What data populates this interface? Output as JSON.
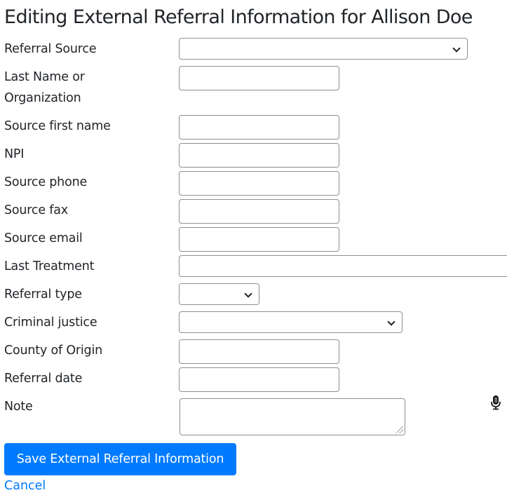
{
  "page": {
    "title": "Editing External Referral Information for Allison Doe"
  },
  "form": {
    "fields": [
      {
        "label": "Referral Source",
        "type": "select",
        "value": ""
      },
      {
        "label": "Last Name or Organization",
        "type": "text",
        "value": ""
      },
      {
        "label": "Source first name",
        "type": "text",
        "value": ""
      },
      {
        "label": "NPI",
        "type": "text",
        "value": ""
      },
      {
        "label": "Source phone",
        "type": "text",
        "value": ""
      },
      {
        "label": "Source fax",
        "type": "text",
        "value": ""
      },
      {
        "label": "Source email",
        "type": "text",
        "value": ""
      },
      {
        "label": "Last Treatment",
        "type": "text",
        "value": ""
      },
      {
        "label": "Referral type",
        "type": "select",
        "value": ""
      },
      {
        "label": "Criminal justice",
        "type": "select",
        "value": ""
      },
      {
        "label": "County of Origin",
        "type": "text",
        "value": ""
      },
      {
        "label": "Referral date",
        "type": "text",
        "value": ""
      },
      {
        "label": "Note",
        "type": "textarea",
        "value": ""
      }
    ],
    "mic_icon": "microphone-icon"
  },
  "actions": {
    "save_label": "Save External Referral Information",
    "cancel_label": "Cancel"
  },
  "colors": {
    "primary": "#007bff",
    "text": "#212529",
    "border": "#8f8f8f"
  }
}
